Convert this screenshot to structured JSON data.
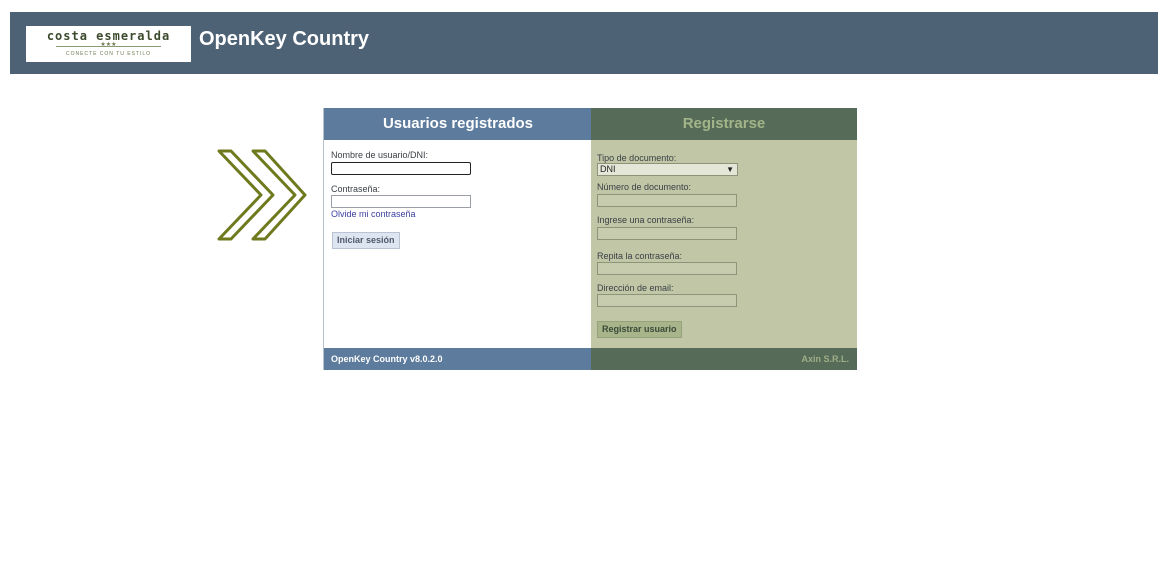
{
  "header": {
    "logo": {
      "name": "costa esmeralda",
      "stars": "★★★",
      "slogan": "CONECTE CON TU ESTILO"
    },
    "title": "OpenKey Country"
  },
  "login": {
    "heading": "Usuarios registrados",
    "username_label": "Nombre de usuario/DNI:",
    "username_value": "",
    "password_label": "Contraseña:",
    "password_value": "",
    "forgot_link": "Olvide mi contraseña",
    "submit_label": "Iniciar sesión",
    "footer": "OpenKey Country  v8.0.2.0"
  },
  "register": {
    "heading": "Registrarse",
    "doc_type_label": "Tipo de documento:",
    "doc_type_selected": "DNI",
    "doc_number_label": "Número de documento:",
    "password_label": "Ingrese una contraseña:",
    "repeat_password_label": "Repita la contraseña:",
    "email_label": "Dirección de email:",
    "submit_label": "Registrar usuario",
    "footer": "Axin S.R.L."
  },
  "colors": {
    "header_bg": "#4e6275",
    "login_accent": "#5d7b9c",
    "register_accent": "#566b58",
    "register_bg": "#c0c6a6",
    "arrow_color": "#6f7a1e"
  },
  "icons": {
    "decoration": "double-chevron-right-icon"
  }
}
